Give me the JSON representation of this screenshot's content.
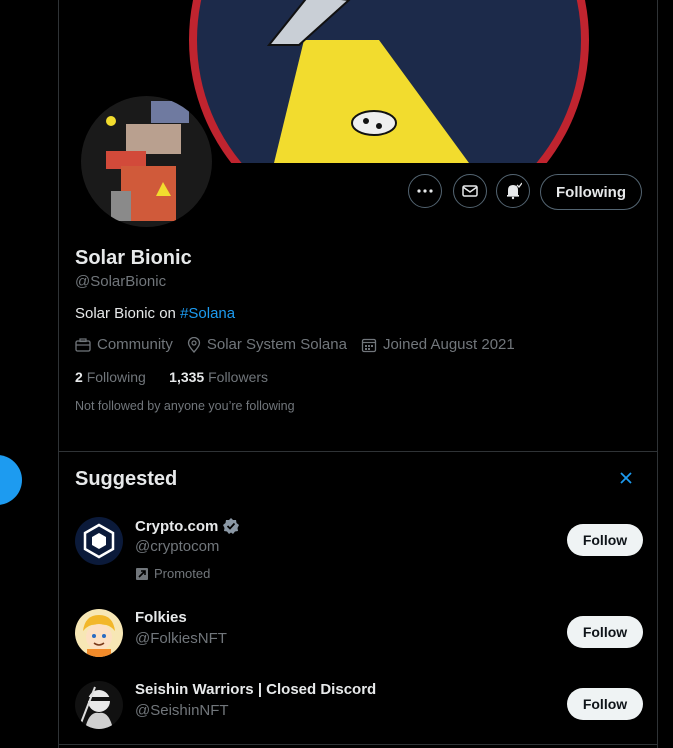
{
  "profile": {
    "name": "Solar Bionic",
    "handle": "@SolarBionic",
    "bio_text": "Solar Bionic on ",
    "bio_hashtag": "#Solana",
    "category": "Community",
    "location": "Solar System Solana",
    "joined": "Joined August 2021",
    "following_count": "2",
    "following_label": "Following",
    "followers_count": "1,335",
    "followers_label": "Followers",
    "not_followed_note": "Not followed by anyone you’re following"
  },
  "actions": {
    "following_button": "Following",
    "icons": [
      "more-icon",
      "mail-icon",
      "notification-bell-icon"
    ]
  },
  "suggested": {
    "title": "Suggested",
    "close_icon": "close-icon",
    "items": [
      {
        "name": "Crypto.com",
        "handle": "@cryptocom",
        "verified": true,
        "promoted_label": "Promoted",
        "follow_label": "Follow"
      },
      {
        "name": "Folkies",
        "handle": "@FolkiesNFT",
        "follow_label": "Follow"
      },
      {
        "name": "Seishin Warriors | Closed Discord",
        "handle": "@SeishinNFT",
        "follow_label": "Follow"
      }
    ]
  },
  "colors": {
    "accent": "#1d9bf0",
    "background": "#000000",
    "muted": "#71767b"
  }
}
